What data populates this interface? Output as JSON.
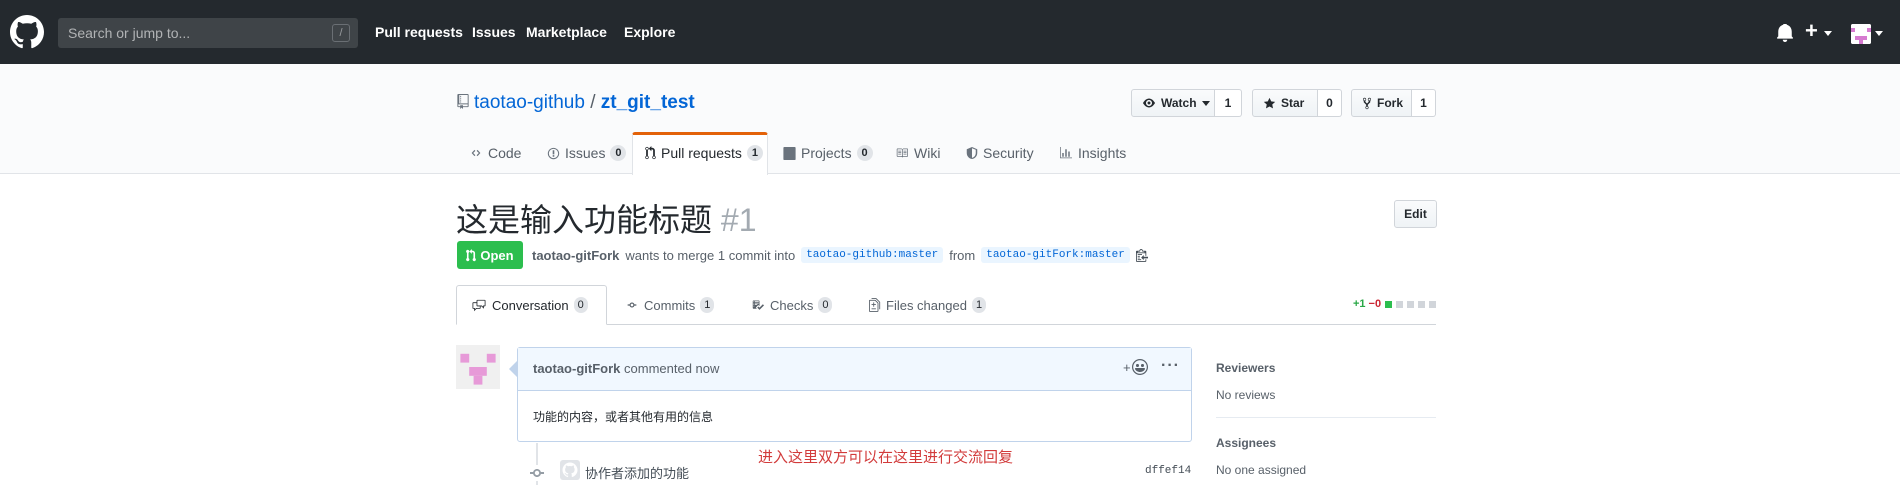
{
  "header": {
    "search_placeholder": "Search or jump to...",
    "slash_hint": "/",
    "nav": [
      "Pull requests",
      "Issues",
      "Marketplace",
      "Explore"
    ],
    "plus_label": "+"
  },
  "repo": {
    "owner": "taotao-github",
    "separator": "/",
    "name": "zt_git_test",
    "watch_label": "Watch",
    "watch_count": "1",
    "star_label": "Star",
    "star_count": "0",
    "fork_label": "Fork",
    "fork_count": "1",
    "tabs": [
      {
        "label": "Code",
        "count": ""
      },
      {
        "label": "Issues",
        "count": "0"
      },
      {
        "label": "Pull requests",
        "count": "1"
      },
      {
        "label": "Projects",
        "count": "0"
      },
      {
        "label": "Wiki",
        "count": ""
      },
      {
        "label": "Security",
        "count": ""
      },
      {
        "label": "Insights",
        "count": ""
      }
    ]
  },
  "pr": {
    "title": "这是输入功能标题",
    "number": "#1",
    "edit_label": "Edit",
    "state": "Open",
    "author": "taotao-gitFork",
    "merge_text": "wants to merge 1 commit into",
    "base_branch": "taotao-github:master",
    "from_text": "from",
    "head_branch": "taotao-gitFork:master",
    "tabs": [
      {
        "label": "Conversation",
        "count": "0"
      },
      {
        "label": "Commits",
        "count": "1"
      },
      {
        "label": "Checks",
        "count": "0"
      },
      {
        "label": "Files changed",
        "count": "1"
      }
    ],
    "additions": "+1",
    "deletions": "−0"
  },
  "comment": {
    "author": "taotao-gitFork",
    "time_text": "commented now",
    "body": "功能的内容，或者其他有用的信息",
    "reaction_plus": "+"
  },
  "annotation": "进入这里双方可以在这里进行交流回复",
  "commit": {
    "message": "协作者添加的功能",
    "sha": "dffef14"
  },
  "sidebar": {
    "reviewers_label": "Reviewers",
    "reviewers_value": "No reviews",
    "assignees_label": "Assignees",
    "assignees_value": "No one assigned"
  },
  "colors": {
    "header_bg": "#24292e",
    "link": "#0366d6",
    "open_green": "#2cbe4e",
    "tab_accent": "#e36209",
    "annotation_red": "#d23b3b"
  }
}
